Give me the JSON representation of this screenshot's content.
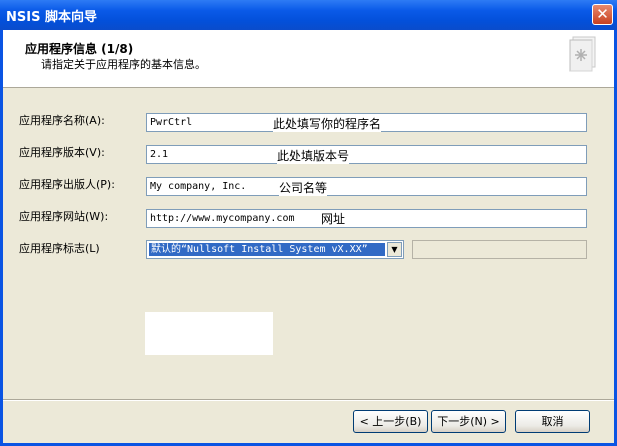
{
  "window": {
    "title": "NSIS 脚本向导",
    "close_symbol": "✕"
  },
  "header": {
    "title": "应用程序信息 (1/8)",
    "subtitle": "请指定关于应用程序的基本信息。",
    "icon": "wizard-document-icon"
  },
  "form": {
    "name": {
      "label": "应用程序名称(A):",
      "value": "PwrCtrl",
      "note": "此处填写你的程序名"
    },
    "version": {
      "label": "应用程序版本(V):",
      "value": "2.1",
      "note": "此处填版本号"
    },
    "publisher": {
      "label": "应用程序出版人(P):",
      "value": "My company, Inc.",
      "note": "公司名等"
    },
    "website": {
      "label": "应用程序网站(W):",
      "value": "http://www.mycompany.com",
      "note": "网址"
    },
    "brand": {
      "label": "应用程序标志(L)",
      "selected": "默认的“Nullsoft Install System vX.XX”",
      "arrow": "▼"
    }
  },
  "buttons": {
    "back": "< 上一步(B)",
    "next": "下一步(N) >",
    "cancel": "取消"
  }
}
